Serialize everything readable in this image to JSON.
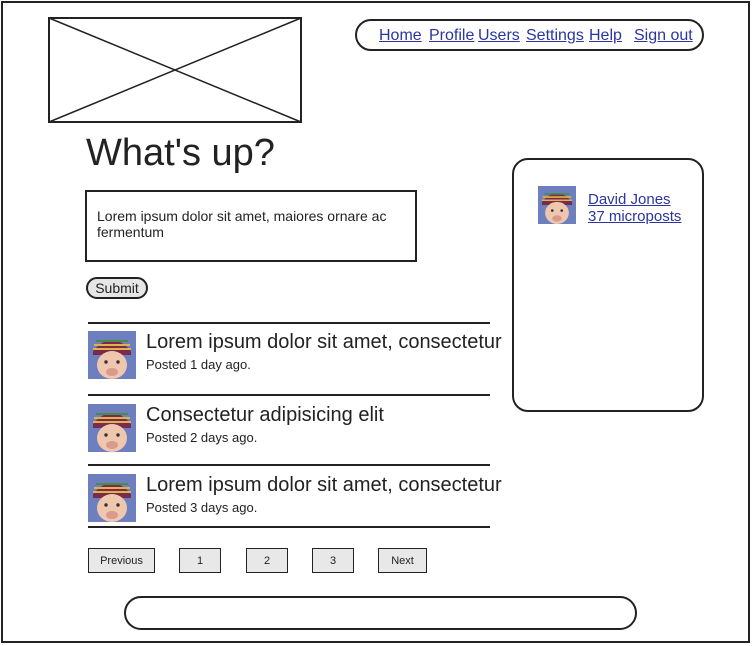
{
  "nav": {
    "home": "Home",
    "profile": "Profile",
    "users": "Users",
    "settings": "Settings",
    "help": "Help",
    "sign_out": "Sign out"
  },
  "main": {
    "heading": "What's up?",
    "composer_text": "Lorem ipsum dolor sit amet, maiores ornare ac fermentum",
    "submit_label": "Submit"
  },
  "posts": [
    {
      "title": "Lorem ipsum dolor sit amet, consectetur",
      "meta": "Posted 1 day ago."
    },
    {
      "title": "Consectetur adipisicing elit",
      "meta": "Posted 2 days ago."
    },
    {
      "title": "Lorem ipsum dolor sit amet, consectetur",
      "meta": "Posted 3 days ago."
    }
  ],
  "pagination": {
    "previous": "Previous",
    "page1": "1",
    "page2": "2",
    "page3": "3",
    "next": "Next"
  },
  "sidebar": {
    "user_name": "David Jones",
    "micropost_count": "37 microposts"
  }
}
